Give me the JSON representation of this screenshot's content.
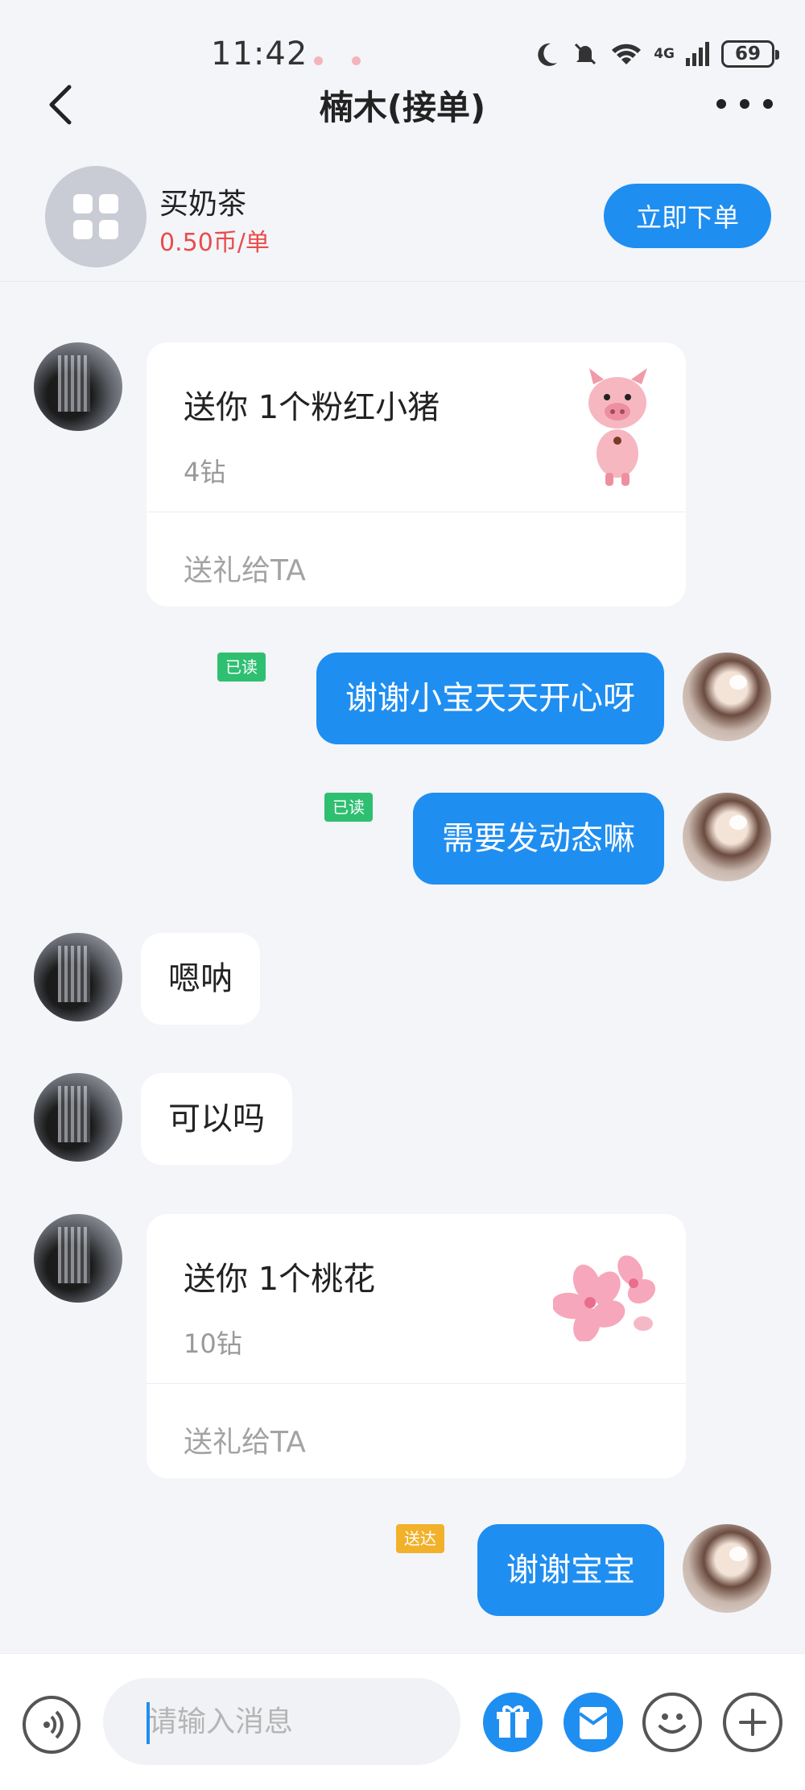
{
  "status_bar": {
    "time": "11:42",
    "battery": "69",
    "network": "4G"
  },
  "header": {
    "title": "楠木(接单)"
  },
  "order": {
    "service_name": "买奶茶",
    "price": "0.50币/单",
    "button_label": "立即下单"
  },
  "messages": [
    {
      "type": "gift",
      "side": "left",
      "title": "送你 1个粉红小猪",
      "cost": "4钻",
      "action": "送礼给TA",
      "gift_icon": "pink-pig"
    },
    {
      "type": "text",
      "side": "right",
      "text": "谢谢小宝天天开心呀",
      "status": "已读"
    },
    {
      "type": "text",
      "side": "right",
      "text": "需要发动态嘛",
      "status": "已读"
    },
    {
      "type": "text",
      "side": "left",
      "text": "嗯呐"
    },
    {
      "type": "text",
      "side": "left",
      "text": "可以吗"
    },
    {
      "type": "gift",
      "side": "left",
      "title": "送你 1个桃花",
      "cost": "10钻",
      "action": "送礼给TA",
      "gift_icon": "peach-blossom"
    },
    {
      "type": "text",
      "side": "right",
      "text": "谢谢宝宝",
      "status": "送达"
    }
  ],
  "input": {
    "placeholder": "请输入消息"
  },
  "colors": {
    "accent": "#1f8ef1",
    "price": "#e94c4c",
    "read_tag": "#2fbf71",
    "sent_tag": "#f2b12a",
    "background": "#f3f5f9"
  }
}
